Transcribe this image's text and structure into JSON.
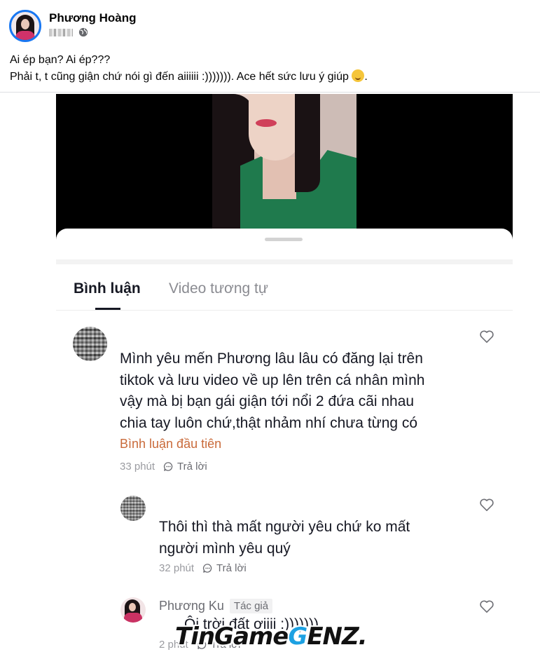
{
  "post": {
    "author": "Phương Hoàng",
    "caption_line1": "Ai ép bạn? Ai ép???",
    "caption_line2": "Phải t, t cũng giận chứ nói gì đến aiiiiii :))))))). Ace hết sức lưu ý giúp ",
    "caption_end": "."
  },
  "tabs": {
    "active": "Bình luận",
    "inactive": "Video tương tự"
  },
  "comments": [
    {
      "lines": [
        "Mình yêu mến Phương lâu lâu có đăng lại trên",
        "tiktok và lưu video về up lên trên cá nhân mình",
        "vậy mà bị bạn gái giận tới nổi 2 đứa cãi nhau",
        "chia tay luôn chứ,thật nhảm nhí chưa từng có"
      ],
      "badge": "Bình luận đầu tiên",
      "time": "33 phút",
      "reply_label": "Trả lời"
    },
    {
      "lines": [
        "Thôi thì thà mất người yêu chứ ko mất",
        "người mình yêu quý"
      ],
      "time": "32 phút",
      "reply_label": "Trả lời"
    },
    {
      "name": "Phương Ku",
      "author_tag": "Tác giả",
      "text": "Ôi trời đất ơiiii :)))))))",
      "time": "2 phút",
      "reply_label": "Trả lời"
    }
  ],
  "watermark": {
    "left": "TinGame",
    "mid": "G",
    "right": "ENZ."
  },
  "colors": {
    "avatar_ring": "#1877f2",
    "first_comment_badge": "#c96a3a",
    "watermark_accent": "#1da1e2"
  },
  "icons": [
    "globe-icon",
    "heart-icon",
    "reply-icon",
    "smile-emoji"
  ]
}
